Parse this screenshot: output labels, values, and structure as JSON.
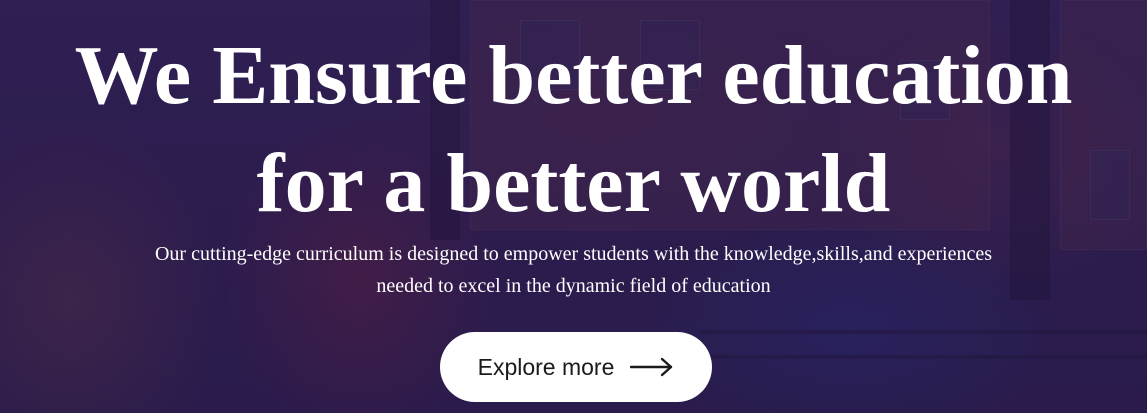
{
  "hero": {
    "headline_line1": "We Ensure better education",
    "headline_line2": "for a better world",
    "subtext_line1": "Our cutting-edge curriculum is designed to empower students with the knowledge,skills,and experiences",
    "subtext_line2": "needed to excel in the dynamic field of education",
    "cta_label": "Explore more",
    "cta_icon": "arrow-right-icon"
  },
  "colors": {
    "overlay": "#261650",
    "text": "#ffffff",
    "button_bg": "#ffffff",
    "button_text": "#1b1b1b"
  }
}
